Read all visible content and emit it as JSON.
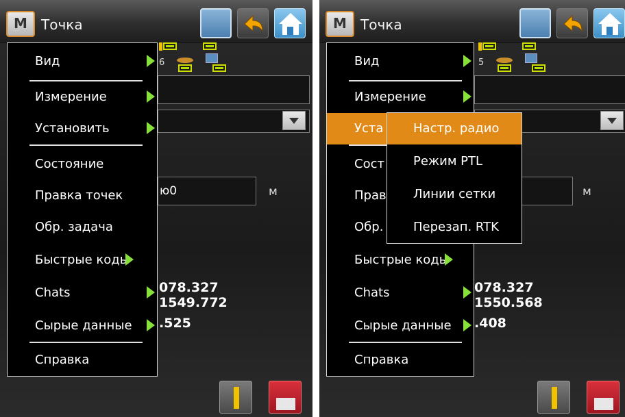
{
  "colors": {
    "accent": "#e28a18",
    "arrow": "#88e03a",
    "menu_bg": "#000000"
  },
  "left": {
    "title": "Точка",
    "m_label": "M",
    "unit": "м",
    "distance_partial": "ю0",
    "sat_count": "6",
    "menu": [
      {
        "label": "Вид",
        "arrow": true
      },
      {
        "label": "Измерение",
        "arrow": true
      },
      {
        "label": "Установить",
        "arrow": true
      },
      {
        "label": "Состояние",
        "arrow": false
      },
      {
        "label": "Правка точек",
        "arrow": false
      },
      {
        "label": "Обр. задача",
        "arrow": false
      },
      {
        "label": "Быстрые коды",
        "arrow": true
      },
      {
        "label": "Chats",
        "arrow": true
      },
      {
        "label": "Сырые данные",
        "arrow": true
      },
      {
        "label": "Справка",
        "arrow": false
      }
    ],
    "coords": [
      "078.327",
      "1549.772",
      ".525"
    ]
  },
  "right": {
    "title": "Точка",
    "m_label": "M",
    "unit": "м",
    "sat_count": "5",
    "menu": [
      {
        "label": "Вид",
        "arrow": true
      },
      {
        "label": "Измерение",
        "arrow": true
      },
      {
        "label": "Уста",
        "arrow": false,
        "selected": true
      },
      {
        "label": "Сост",
        "arrow": false
      },
      {
        "label": "Прав",
        "arrow": false
      },
      {
        "label": "Обр.",
        "arrow": false
      },
      {
        "label": "Быстрые коды",
        "arrow": true
      },
      {
        "label": "Chats",
        "arrow": true
      },
      {
        "label": "Сырые данные",
        "arrow": true
      },
      {
        "label": "Справка",
        "arrow": false
      }
    ],
    "submenu": [
      {
        "label": "Настр. радио",
        "selected": true
      },
      {
        "label": "Режим PTL"
      },
      {
        "label": "Линии сетки"
      },
      {
        "label": "Перезап. RTK"
      }
    ],
    "coords": [
      "078.327",
      "1550.568",
      ".408"
    ]
  },
  "icons": [
    "list-icon",
    "back-arrow-icon",
    "home-icon",
    "surveyor-icon",
    "save-icon",
    "battery-icon",
    "satellite-icon",
    "receiver-icon"
  ]
}
